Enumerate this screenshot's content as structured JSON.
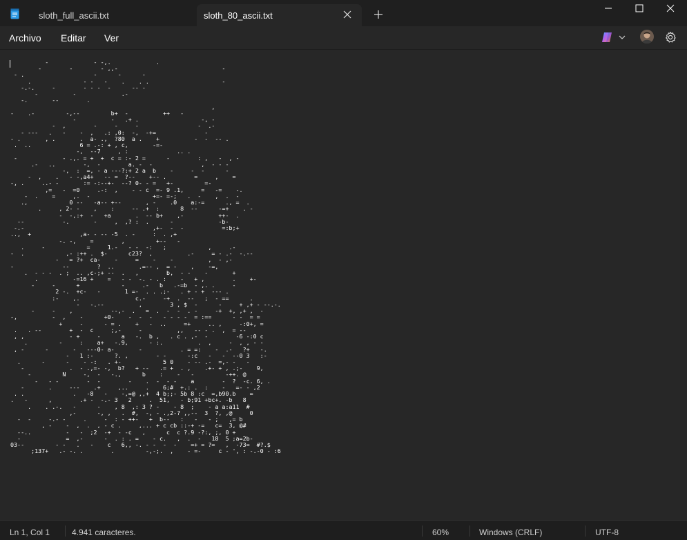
{
  "tabs": [
    {
      "label": "sloth_full_ascii.txt"
    },
    {
      "label": "sloth_80_ascii.txt"
    }
  ],
  "menu": {
    "archivo": "Archivo",
    "editar": "Editar",
    "ver": "Ver"
  },
  "toolbar_icons": [
    "copilot-icon",
    "chevron-down-icon",
    "avatar",
    "gear-icon"
  ],
  "editor": {
    "lines": [
      "          -             - -,.             .",
      "        -        -        - ,,-                              -",
      " - .                    -      -      -",
      "     .               - -   -    .    . .                     -",
      "   -.-.     -        - - -  -      -- -",
      "       -          -             .-",
      "   -.       --        .",
      "                                                          ,",
      "-    .-         -,--         b+  -          ++   -",
      "                  -          -   .+ .                  -, -",
      "            -  ,        -     -     -                 -  .-",
      "   - ---   .   -    -  ,   .: ,0:  -,  -+=              -",
      "- .       , .       .  a- .,  ?80  a .    +          -  -  -- .",
      " .  ..              6 = .-: + , c,       -=-",
      "                   -,  --7     , :              .. .",
      " -             - .,. = +  +  c = :- 2 =      -        : ,   -  , -",
      "      .-   ..        -,  -        a. -  -              ,  - - -",
      "               -,  :  =, - a ---?:+ 2 a  b    -     -  -      -",
      "     -  ,    .   - -,a4+   -- =  ?--    +-- .        =     ,    =",
      "-, .     ..- -       := -:--+-  --? 0- - =   +-         =-",
      "          ,=   -  =0     .-:  ,    - - c  =- 9 .1,     =   -=    -.",
      "    -  .    =     ,.  -                  +=- =-;   .  -    ,  .  -",
      "   .,            0 --   -a-- +--       , -    .0    a:-=      ., =  .",
      "        .     , 2- -    ,    :     -- .+  :      8  --      -=+    . -",
      "              -  -,:+  -   +a       .  -- b+    ,-          ++-  .",
      "  --           -.       -     ,  ,? :  .      -             -b-",
      " -.-                                     ,+-  -  -           =:b;+",
      "..,  +              ,a- - -- -5  . -     :  . ,+",
      "              -. -,    =        ,         +--   -",
      "   .     -            =     1.-   - -  -:   ;            ,     .-",
      "-  .            ,- :++ .  $-      c23?  ,          .-     = - .-  -.--",
      "             -   = ?+  ca-    -     =    -    -          ,  - ,-",
      "-              --        ?  ..       .=-- ,  = -    ,    -=,",
      "    .  - - -  . ;  .. ,c-;+ --  .   ,        b,  - -    -       +",
      "       .          -=16 +    =   - -  -. - . :    -   + ,        .    +-",
      "      -     -      +            -     .-   b   .-=b  - ,. .     -",
      "             2 -.  +c-   -       1 =-  . . .;-   . + - +  --- .",
      "            :-    ,.                c.-     -+  .  --   ;  - ==      .",
      "                   -   -.--          ,        3 , $  -      -     + ,+ - --.-.",
      "      -     -    ,           --,-  .   =  .  -  -  . -     -+  +, ,+ ,  -",
      "-,          -  ,    -      +0-    -  -  -   - - - -  = :==      - -  = =",
      "              +     -      - = .    +   -  ..     =+     .. ,     -:0+, =",
      " .   . --        +  -  c     ;,-     -          ,,   -- - .  ,  = --",
      " , ,             - +     -      a   -.  b ,   . c . ,-  -        -6 -:0 c",
      "    .         -     :    a+   -.9,      - :.          .  ,     -  , , - -",
      " , -      -       -   ---0- a-       -           . = =:    -  .-   ?+   -.",
      "                -   1 :-      ?. ,        - -      -:c   -   -  --0 3   :-",
      "  .      -      -    - -:   . +-            5 0    - -- .-  =,- -   -",
      "   -             .  - .,=- -,  b?   + --   .= +  . ,    .+- + , .;-    9,",
      "     -         N     -,  -   -.,      b    :    -   -         -++. @",
      "       -   - -        -  -        -    .  -  - -    a        -  ?  -c. 6, .",
      "   -       .     ---    .+     ,..     .    6;#  +.: .  :    -   =- - ,2",
      " . .              .   -8   -    -,=@ ,,+  4 b;;- 5b 8 :c  =,b90.b    =",
      ".   -      ,        .+ -  -.- 3   2     .  51,   - b;91 +bc+. -b   8",
      "     .    . .-.   -      -    , 8  ,: 3 ? -    - 8  ;    - a a:a11  #",
      "                 ,-      -, ,   .  #,  -, - .,2-? ,,--  3  ?, ,@     0",
      "  -  -     -.- -     .     -  : - ++-   +  b--   :   -   - ;   ,= b",
      "         , -    -  ,  .  , - c .     ,... + c cb ::-+ -=   c=  3, @#",
      "  --..          -   -  ;2  -+  - -c   ,      c  c ?.9 -?:, ;, 0 +",
      "  -             =  ,-      -  . : . =    - c.   ,  .  -   18  5 ;a=2b-",
      "03--         - -   .   -    c   6,, -. - -  -  -    =+ = ?=   ,  -73=  #?.$",
      "      ;137+   .- -. .        .         -,-;.  ,    - =-     c - ', : -.-0 - :6"
    ]
  },
  "status": {
    "position": "Ln 1, Col 1",
    "chars": "4.941 caracteres.",
    "zoom": "60%",
    "line_ending": "Windows (CRLF)",
    "encoding": "UTF-8"
  },
  "colors": {
    "background": "#272727",
    "titlebar": "#1f1f1f",
    "statusbar": "#1e1e1e",
    "text": "#ffffff",
    "app_icon": "#2b9ae6"
  }
}
